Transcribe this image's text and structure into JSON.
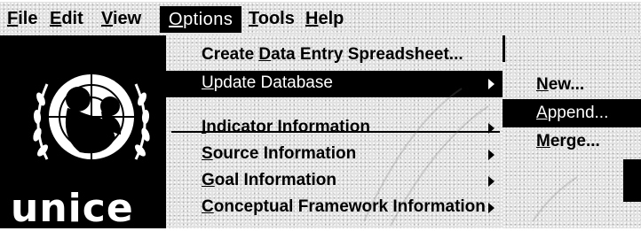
{
  "menubar": {
    "items": [
      {
        "label": "File"
      },
      {
        "label": "Edit"
      },
      {
        "label": "View"
      },
      {
        "label": "Options"
      },
      {
        "label": "Tools"
      },
      {
        "label": "Help"
      }
    ]
  },
  "logo": {
    "text": "unice",
    "icon": "un-emblem-icon"
  },
  "options_menu": {
    "items": [
      {
        "pre": "Create ",
        "u": "D",
        "post": "ata Entry Spreadsheet...",
        "submenu": false
      },
      {
        "pre": "",
        "u": "U",
        "post": "pdate Database",
        "submenu": true
      },
      {
        "pre": "",
        "u": "I",
        "post": "ndicator Information",
        "submenu": true
      },
      {
        "pre": "",
        "u": "S",
        "post": "ource Information",
        "submenu": true
      },
      {
        "pre": "",
        "u": "G",
        "post": "oal Information",
        "submenu": true
      },
      {
        "pre": "",
        "u": "C",
        "post": "onceptual Framework Information",
        "submenu": true
      }
    ]
  },
  "update_submenu": {
    "items": [
      {
        "u": "N",
        "post": "ew..."
      },
      {
        "u": "A",
        "post": "ppend..."
      },
      {
        "u": "M",
        "post": "erge..."
      }
    ]
  },
  "colors": {
    "highlight": "#000000",
    "menu_bg": "#e2e2e2"
  }
}
